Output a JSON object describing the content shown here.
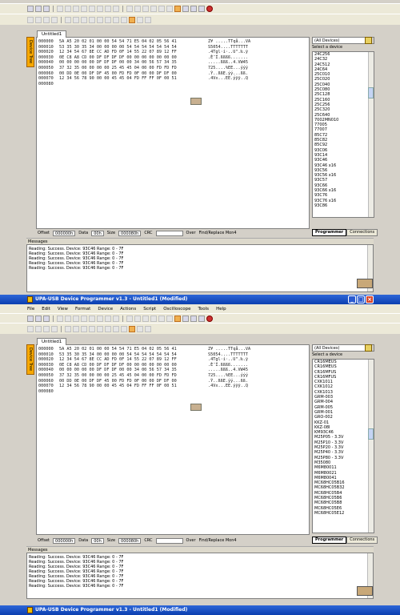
{
  "app": {
    "title": "UPA-USB Device Programmer v1.3 - Untitled1 (Modified)"
  },
  "menu": [
    "File",
    "Edit",
    "View",
    "Format",
    "Device",
    "Actions",
    "Script",
    "Oscilloscope",
    "Tools",
    "Help"
  ],
  "side_tab_label": "Device Tree",
  "document_tab": "Untitled1",
  "hex_rows": [
    {
      "addr": "000000",
      "bytes": "5A A5 20 02 01 00 00 54 54 71 E5 04 02 05 56 41",
      "ascii": "Z¥ .....TTqå...VA"
    },
    {
      "addr": "000010",
      "bytes": "53 35 30 35 34 00 00 00 00 54 54 54 54 54 54 54",
      "ascii": "S5054....TTTTTTT"
    },
    {
      "addr": "000020",
      "bytes": "12 34 54 67 8E CC AD FD 0F 14 55 22 07 89 12 FF",
      "ascii": ".4Tgl·í·..U\".‰.ÿ"
    },
    {
      "addr": "000030",
      "bytes": "0E C8 A8 CD 00 DF DF DF DF 00 00 00 00 00 00 00",
      "ascii": ".È¨Í.ßßßß......."
    },
    {
      "addr": "000040",
      "bytes": "00 00 00 00 00 DF DF DF 00 00 34 00 56 57 34 35",
      "ascii": ".....ßßß..4.VW45"
    },
    {
      "addr": "000050",
      "bytes": "37 32 35 00 00 00 00 25 45 45 04 00 00 FD FD FD",
      "ascii": "725....%EE...ýýý"
    },
    {
      "addr": "000060",
      "bytes": "00 DD 0E 00 DF DF 45 00 FD FD 0F 00 00 DF DF 00",
      "ascii": ".Ý..ßßE.ýý...ßß."
    },
    {
      "addr": "000070",
      "bytes": "12 34 56 78 90 00 00 45 45 04 FD FF FF 0F 00 51",
      "ascii": ".4Vx...EE.ýÿÿ..Q"
    },
    {
      "addr": "000080",
      "bytes": "",
      "ascii": ""
    }
  ],
  "statusbar": {
    "offset_label": "Offset",
    "offset_value": "000000h",
    "data_label": "Data",
    "data_value": "00h",
    "size_label": "Size",
    "size_value": "000080h",
    "crc_label": "CRC",
    "over_label": "Over",
    "find_label": "Find/Replace Mon4"
  },
  "device_filter": "(All Devices)",
  "device_label": "Select a device",
  "device_list_top": [
    "24C256",
    "24C32",
    "24C512",
    "24C64",
    "25C010",
    "25C020",
    "25C040",
    "25C080",
    "25C128",
    "25C160",
    "25C256",
    "25C320",
    "25C640",
    "7002MN010",
    "77005",
    "77007",
    "85C72",
    "85C82",
    "85C92",
    "93C06",
    "93C14",
    "93C46",
    "93C46 x16",
    "93C56",
    "93C56 x16",
    "93C57",
    "93C66",
    "93C66 x16",
    "93C76",
    "93C76 x16",
    "93C86"
  ],
  "device_list_bottom": [
    "CR16MEUS",
    "CR16MEUS",
    "CR16MFUS",
    "CR16MFUS",
    "CXK1011",
    "CXK1012",
    "CXK1013",
    "GRM-003",
    "GRM-004",
    "GRM-005",
    "GRM-001",
    "GRO-002",
    "KKZ-01",
    "KKZ-08I",
    "KM93C46",
    "M25P05 - 3.3V",
    "M25P10 - 3.3V",
    "M25P20 - 3.3V",
    "M25P40 - 3.3V",
    "M25P80 - 3.3V",
    "M35080",
    "M6M80011",
    "M6M80021",
    "M6M80041",
    "MC68HC05B16",
    "MC68HC05B32",
    "MC68HC05B4",
    "MC68HC05B6",
    "MC68HC05B8",
    "MC68HC05E6",
    "MC68HC05E12"
  ],
  "right_tabs": [
    "Programmer",
    "Connections"
  ],
  "messages_title": "Messages",
  "messages_top": [
    "Reading: Success. Device: 93C46 Range: 0 - 7F",
    "Reading: Success. Device: 93C46 Range: 0 - 7F",
    "Reading: Success. Device: 93C46 Range: 0 - 7F",
    "Reading: Success. Device: 93C46 Range: 0 - 7F",
    "Reading: Success. Device: 93C46 Range: 0 - 7F"
  ],
  "messages_bottom": [
    "Reading: Success. Device: 93C46 Range: 0 - 7F",
    "Reading: Success. Device: 93C46 Range: 0 - 7F",
    "Reading: Success. Device: 93C46 Range: 0 - 7F",
    "Reading: Success. Device: 93C46 Range: 0 - 7F",
    "Reading: Success. Device: 93C46 Range: 0 - 7F",
    "Reading: Success. Device: 93C46 Range: 0 - 7F",
    "Reading: Success. Device: 93C46 Range: 0 - 7F"
  ]
}
